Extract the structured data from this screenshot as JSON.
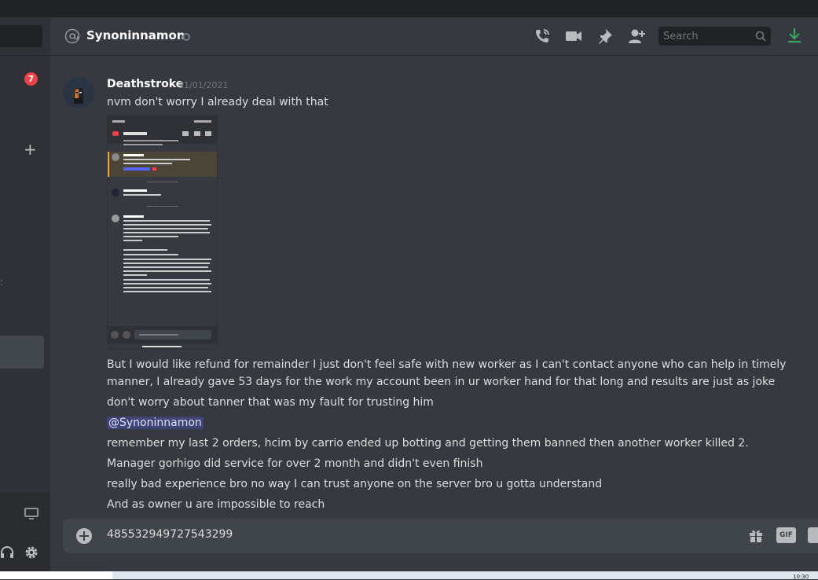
{
  "sidebar": {
    "unread_badge": "7",
    "add_label": "+"
  },
  "header": {
    "channel_name": "Synoninnamon",
    "search_placeholder": "Search"
  },
  "message": {
    "author": "Deathstroke",
    "timestamp": "11/01/2021",
    "lines": [
      "nvm don't worry I already deal with that",
      "But I would like refund for remainder I just don't feel safe with new worker as I can't contact anyone who can help in timely manner, I already gave 53 days for the work my account been in ur worker hand for that long and results are just as joke",
      "don't worry about tanner that was my fault for trusting him",
      "@Synoninnamon",
      "remember my last 2 orders, hcim by carrio ended up botting and getting them banned then another worker killed 2.",
      "Manager gorhigo did service for over 2 month and didn't even finish",
      "really bad experience bro no way I can trust anyone on the server bro u gotta understand",
      "And as owner u are impossible to reach"
    ]
  },
  "composer": {
    "text": "485532949727543299",
    "gif_label": "GIF"
  },
  "taskbar": {
    "clock": "10:30"
  },
  "colors": {
    "background": "#36393f",
    "sidebar": "#2f3136",
    "mention_bg": "#414675",
    "badge": "#ed4245",
    "download_green": "#3ba55d"
  }
}
